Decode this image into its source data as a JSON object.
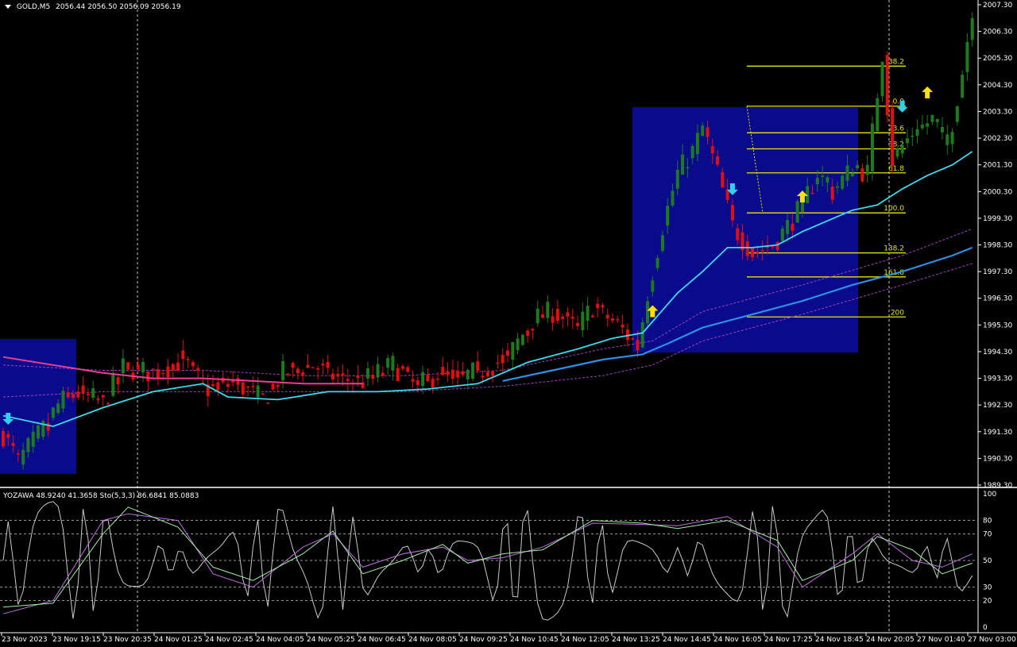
{
  "header": {
    "symbol": "GOLD,M5",
    "ohlc": "2056.44 2056.50 2056.09 2056.19"
  },
  "sub_header": {
    "text": "YOZAWA 48.9240 41.3658  Sto(5,3,3) 86.6841 85.0883"
  },
  "colors": {
    "background": "#000000",
    "bull": "#1e7a1e",
    "bear": "#e01010",
    "box": "#0a0a8c",
    "ema_fast": "#3fd9ec",
    "ema_slow": "#2e8fe6",
    "ema_old": "#ee3d94",
    "band": "#a040c0",
    "fib": "#e6e600",
    "arrow_up": "#ffe000",
    "arrow_down": "#30d0f0",
    "osc_main": "#c8c8c8",
    "osc_k": "#c070e0",
    "osc_d": "#a0f0a0",
    "grid": "#c8c8c8",
    "text": "#ffffff"
  },
  "chart_data": [
    {
      "type": "candlestick",
      "ylim": [
        1989.3,
        2007.3
      ],
      "y_ticks": [
        "2007.30",
        "2006.30",
        "2005.30",
        "2004.30",
        "2003.30",
        "2002.30",
        "2001.30",
        "2000.30",
        "1999.30",
        "1998.30",
        "1997.30",
        "1996.30",
        "1995.30",
        "1994.30",
        "1993.30",
        "1992.30",
        "1991.30",
        "1990.30",
        "1989.30"
      ],
      "x_ticks": [
        "23 Nov 2023",
        "23 Nov 19:15",
        "23 Nov 20:35",
        "24 Nov 01:25",
        "24 Nov 02:45",
        "24 Nov 04:05",
        "24 Nov 05:25",
        "24 Nov 06:45",
        "24 Nov 08:05",
        "24 Nov 09:25",
        "24 Nov 10:45",
        "24 Nov 12:05",
        "24 Nov 13:25",
        "24 Nov 14:45",
        "24 Nov 16:05",
        "24 Nov 17:25",
        "24 Nov 18:45",
        "24 Nov 20:05",
        "27 Nov 01:40",
        "27 Nov 03:00"
      ],
      "fib_levels": [
        {
          "label": "-38.2",
          "value": 2005.0
        },
        {
          "label": "0.0",
          "value": 2003.5
        },
        {
          "label": "23.6",
          "value": 2002.5
        },
        {
          "label": "38.2",
          "value": 2001.9
        },
        {
          "label": "61.8",
          "value": 2001.0
        },
        {
          "label": "100.0",
          "value": 1999.5
        },
        {
          "label": "138.2",
          "value": 1998.0
        },
        {
          "label": "161.8",
          "value": 1997.1
        },
        {
          "label": "200",
          "value": 1995.6
        }
      ],
      "price_path": [
        [
          0,
          1991.2
        ],
        [
          3,
          1990.2
        ],
        [
          8,
          1991.4
        ],
        [
          11,
          1992.3
        ],
        [
          14,
          1992.8
        ],
        [
          20,
          1992.4
        ],
        [
          24,
          1993.7
        ],
        [
          30,
          1993.5
        ],
        [
          36,
          1994.0
        ],
        [
          41,
          1992.9
        ],
        [
          46,
          1993.2
        ],
        [
          52,
          1992.5
        ],
        [
          56,
          1993.5
        ],
        [
          62,
          1993.8
        ],
        [
          67,
          1993.3
        ],
        [
          72,
          1993.2
        ],
        [
          78,
          1993.8
        ],
        [
          83,
          1993.0
        ],
        [
          87,
          1993.5
        ],
        [
          91,
          1993.3
        ],
        [
          96,
          1993.6
        ],
        [
          101,
          1994.1
        ],
        [
          106,
          1995.5
        ],
        [
          110,
          1995.8
        ],
        [
          115,
          1995.2
        ],
        [
          118,
          1996.0
        ],
        [
          123,
          1995.3
        ],
        [
          127,
          1994.5
        ],
        [
          129,
          1996.5
        ],
        [
          132,
          1999.0
        ],
        [
          135,
          2001.0
        ],
        [
          138,
          2001.8
        ],
        [
          140,
          2002.7
        ],
        [
          143,
          2001.0
        ],
        [
          146,
          1999.0
        ],
        [
          150,
          1998.0
        ],
        [
          154,
          1998.3
        ],
        [
          157,
          1999.0
        ],
        [
          160,
          1999.8
        ],
        [
          163,
          2001.0
        ],
        [
          166,
          2000.3
        ],
        [
          170,
          2001.2
        ],
        [
          173,
          2001.0
        ],
        [
          176,
          2005.5
        ],
        [
          178,
          2001.5
        ],
        [
          182,
          2002.5
        ],
        [
          186,
          2003.0
        ],
        [
          189,
          2002.0
        ],
        [
          192,
          2004.8
        ],
        [
          194,
          2007.2
        ]
      ],
      "ema_fast": [
        [
          0,
          1991.9
        ],
        [
          10,
          1991.5
        ],
        [
          20,
          1992.2
        ],
        [
          30,
          1992.8
        ],
        [
          40,
          1993.1
        ],
        [
          45,
          1992.6
        ],
        [
          55,
          1992.5
        ],
        [
          65,
          1992.8
        ],
        [
          75,
          1992.8
        ],
        [
          85,
          1992.9
        ],
        [
          95,
          1993.1
        ],
        [
          105,
          1993.9
        ],
        [
          115,
          1994.4
        ],
        [
          122,
          1994.8
        ],
        [
          128,
          1995.0
        ],
        [
          135,
          1996.5
        ],
        [
          140,
          1997.3
        ],
        [
          145,
          1998.2
        ],
        [
          150,
          1998.2
        ],
        [
          155,
          1998.3
        ],
        [
          160,
          1998.8
        ],
        [
          165,
          1999.2
        ],
        [
          170,
          1999.6
        ],
        [
          175,
          1999.8
        ],
        [
          180,
          2000.4
        ],
        [
          185,
          2000.9
        ],
        [
          190,
          2001.3
        ],
        [
          194,
          2001.8
        ]
      ],
      "ema_slow": [
        [
          100,
          1993.2
        ],
        [
          110,
          1993.6
        ],
        [
          120,
          1994.0
        ],
        [
          128,
          1994.2
        ],
        [
          133,
          1994.6
        ],
        [
          140,
          1995.2
        ],
        [
          150,
          1995.7
        ],
        [
          160,
          1996.2
        ],
        [
          170,
          1996.8
        ],
        [
          180,
          1997.3
        ],
        [
          190,
          1997.9
        ],
        [
          194,
          1998.2
        ]
      ],
      "ema_old": [
        [
          0,
          1994.1
        ],
        [
          10,
          1993.8
        ],
        [
          20,
          1993.5
        ],
        [
          30,
          1993.3
        ],
        [
          40,
          1993.3
        ],
        [
          50,
          1993.2
        ],
        [
          60,
          1993.1
        ],
        [
          72,
          1993.1
        ]
      ],
      "band_upper": [
        [
          0,
          1993.8
        ],
        [
          20,
          1993.6
        ],
        [
          40,
          1993.6
        ],
        [
          60,
          1993.4
        ],
        [
          80,
          1993.4
        ],
        [
          100,
          1993.6
        ],
        [
          120,
          1994.4
        ],
        [
          130,
          1994.7
        ],
        [
          140,
          1995.8
        ],
        [
          160,
          1996.8
        ],
        [
          180,
          1997.9
        ],
        [
          194,
          1998.9
        ]
      ],
      "band_lower": [
        [
          0,
          1992.6
        ],
        [
          20,
          1992.8
        ],
        [
          40,
          1992.8
        ],
        [
          60,
          1992.8
        ],
        [
          80,
          1992.8
        ],
        [
          100,
          1993.0
        ],
        [
          120,
          1993.4
        ],
        [
          130,
          1993.8
        ],
        [
          140,
          1994.7
        ],
        [
          160,
          1995.7
        ],
        [
          180,
          1996.8
        ],
        [
          194,
          1997.6
        ]
      ],
      "arrows_up": [
        [
          130,
          1995.8
        ],
        [
          160,
          2000.1
        ],
        [
          185,
          2004.0
        ]
      ],
      "arrows_down": [
        [
          1,
          1991.8
        ],
        [
          146,
          2000.4
        ],
        [
          180,
          2003.5
        ]
      ]
    },
    {
      "type": "line",
      "ylim": [
        0,
        100
      ],
      "y_ticks": [
        "100",
        "80",
        "70",
        "50",
        "30",
        "20",
        "0"
      ],
      "levels": [
        80,
        70,
        50,
        30,
        20
      ],
      "k_line": [
        [
          0,
          10
        ],
        [
          10,
          20
        ],
        [
          20,
          80
        ],
        [
          25,
          85
        ],
        [
          35,
          80
        ],
        [
          42,
          40
        ],
        [
          50,
          30
        ],
        [
          60,
          60
        ],
        [
          66,
          70
        ],
        [
          72,
          45
        ],
        [
          80,
          55
        ],
        [
          88,
          60
        ],
        [
          93,
          50
        ],
        [
          100,
          52
        ],
        [
          108,
          60
        ],
        [
          118,
          78
        ],
        [
          128,
          77
        ],
        [
          135,
          76
        ],
        [
          145,
          83
        ],
        [
          155,
          60
        ],
        [
          160,
          30
        ],
        [
          170,
          55
        ],
        [
          175,
          70
        ],
        [
          182,
          50
        ],
        [
          188,
          45
        ],
        [
          194,
          55
        ]
      ],
      "d_line": [
        [
          0,
          15
        ],
        [
          10,
          18
        ],
        [
          20,
          70
        ],
        [
          25,
          90
        ],
        [
          35,
          75
        ],
        [
          42,
          45
        ],
        [
          50,
          35
        ],
        [
          60,
          55
        ],
        [
          66,
          72
        ],
        [
          72,
          40
        ],
        [
          80,
          50
        ],
        [
          88,
          62
        ],
        [
          93,
          48
        ],
        [
          100,
          55
        ],
        [
          108,
          58
        ],
        [
          118,
          80
        ],
        [
          128,
          78
        ],
        [
          135,
          74
        ],
        [
          145,
          80
        ],
        [
          155,
          65
        ],
        [
          160,
          35
        ],
        [
          170,
          50
        ],
        [
          175,
          68
        ],
        [
          182,
          58
        ],
        [
          188,
          40
        ],
        [
          194,
          48
        ]
      ]
    }
  ]
}
